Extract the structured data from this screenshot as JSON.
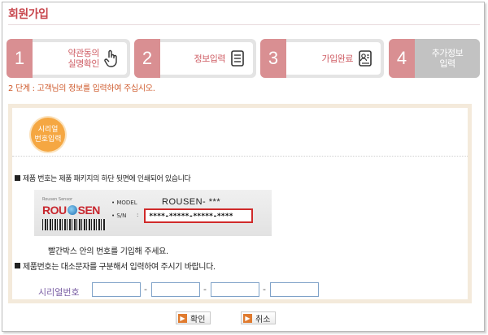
{
  "page": {
    "title": "회원가입"
  },
  "steps": [
    {
      "num": "1",
      "label_line1": "약관동의",
      "label_line2": "실명확인",
      "icon": "hand-pointer-icon"
    },
    {
      "num": "2",
      "label_line1": "정보입력",
      "label_line2": "",
      "icon": "document-icon"
    },
    {
      "num": "3",
      "label_line1": "가입완료",
      "label_line2": "",
      "icon": "id-card-icon"
    },
    {
      "num": "4",
      "label_line1": "추가정보",
      "label_line2": "입력",
      "icon": ""
    }
  ],
  "step_desc": "2 단계 : 고객님의 정보를 입력하여 주십시오.",
  "badge": {
    "line1": "시리얼",
    "line2": "번호입력"
  },
  "notices": {
    "n1": "제품 번호는 제품 패키지의 하단 뒷면에 인쇄되어 있습니다",
    "n2": "빨간박스 안의 번호를 기입해 주세요.",
    "n3": "제품번호는 대소문자를 구분해서 입력하여 주시기 바랍니다."
  },
  "label_card": {
    "brand_small": "Rousen Sensor",
    "brand_left": "ROU",
    "brand_right": "SEN",
    "model_label": "• MODEL",
    "model_value": "ROUSEN- ***",
    "sn_label": "• S/N",
    "sn_colon": ":",
    "sn_value": "****-*****-*****-****"
  },
  "serial": {
    "label": "시리얼번호",
    "dash": "-"
  },
  "buttons": {
    "ok": "확인",
    "cancel": "취소",
    "arrow": "▶"
  },
  "colors": {
    "accent": "#c8474e",
    "step_num_bg": "#d98f92",
    "badge": "#f5a742",
    "panel_border": "#f4eadb",
    "sn_box": "#d02a2a"
  }
}
